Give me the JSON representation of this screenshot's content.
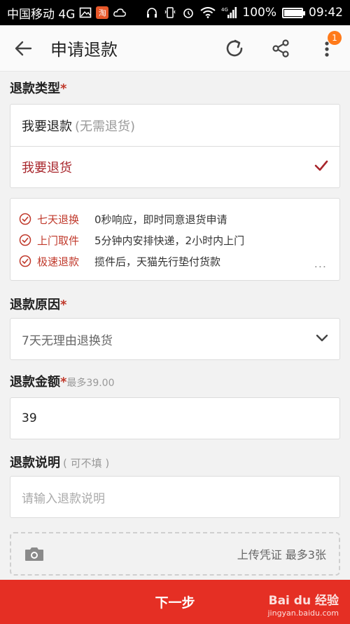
{
  "status_bar": {
    "carrier": "中国移动 4G",
    "network": "4G",
    "battery": "100%",
    "time": "09:42",
    "taobao_badge": "淘"
  },
  "appbar": {
    "title": "申请退款",
    "notification_count": "1"
  },
  "refund_type": {
    "label": "退款类型",
    "required_mark": "*",
    "options": [
      {
        "main": "我要退款",
        "sub": "(无需退货)",
        "selected": false
      },
      {
        "main": "我要退货",
        "sub": "",
        "selected": true
      }
    ]
  },
  "benefits": [
    {
      "name": "七天退换",
      "desc": "0秒响应，即时同意退货申请"
    },
    {
      "name": "上门取件",
      "desc": "5分钟内安排快递，2小时内上门"
    },
    {
      "name": "极速退款",
      "desc": "揽件后，天猫先行垫付货款"
    }
  ],
  "benefits_more": "...",
  "refund_reason": {
    "label": "退款原因",
    "required_mark": "*",
    "value": "7天无理由退换货"
  },
  "refund_amount": {
    "label": "退款金额",
    "required_mark": "*",
    "hint": "最多39.00",
    "value": "39"
  },
  "refund_note": {
    "label": "退款说明",
    "hint": "( 可不填 )",
    "placeholder": "请输入退款说明"
  },
  "upload": {
    "label": "上传凭证 最多3张"
  },
  "footer": {
    "next_label": "下一步",
    "watermark": "Bai du 经验",
    "watermark_sub": "jingyan.baidu.com"
  },
  "colors": {
    "accent_red": "#e52f24",
    "selected_text": "#a8262c",
    "badge_orange": "#ff7a1a"
  }
}
